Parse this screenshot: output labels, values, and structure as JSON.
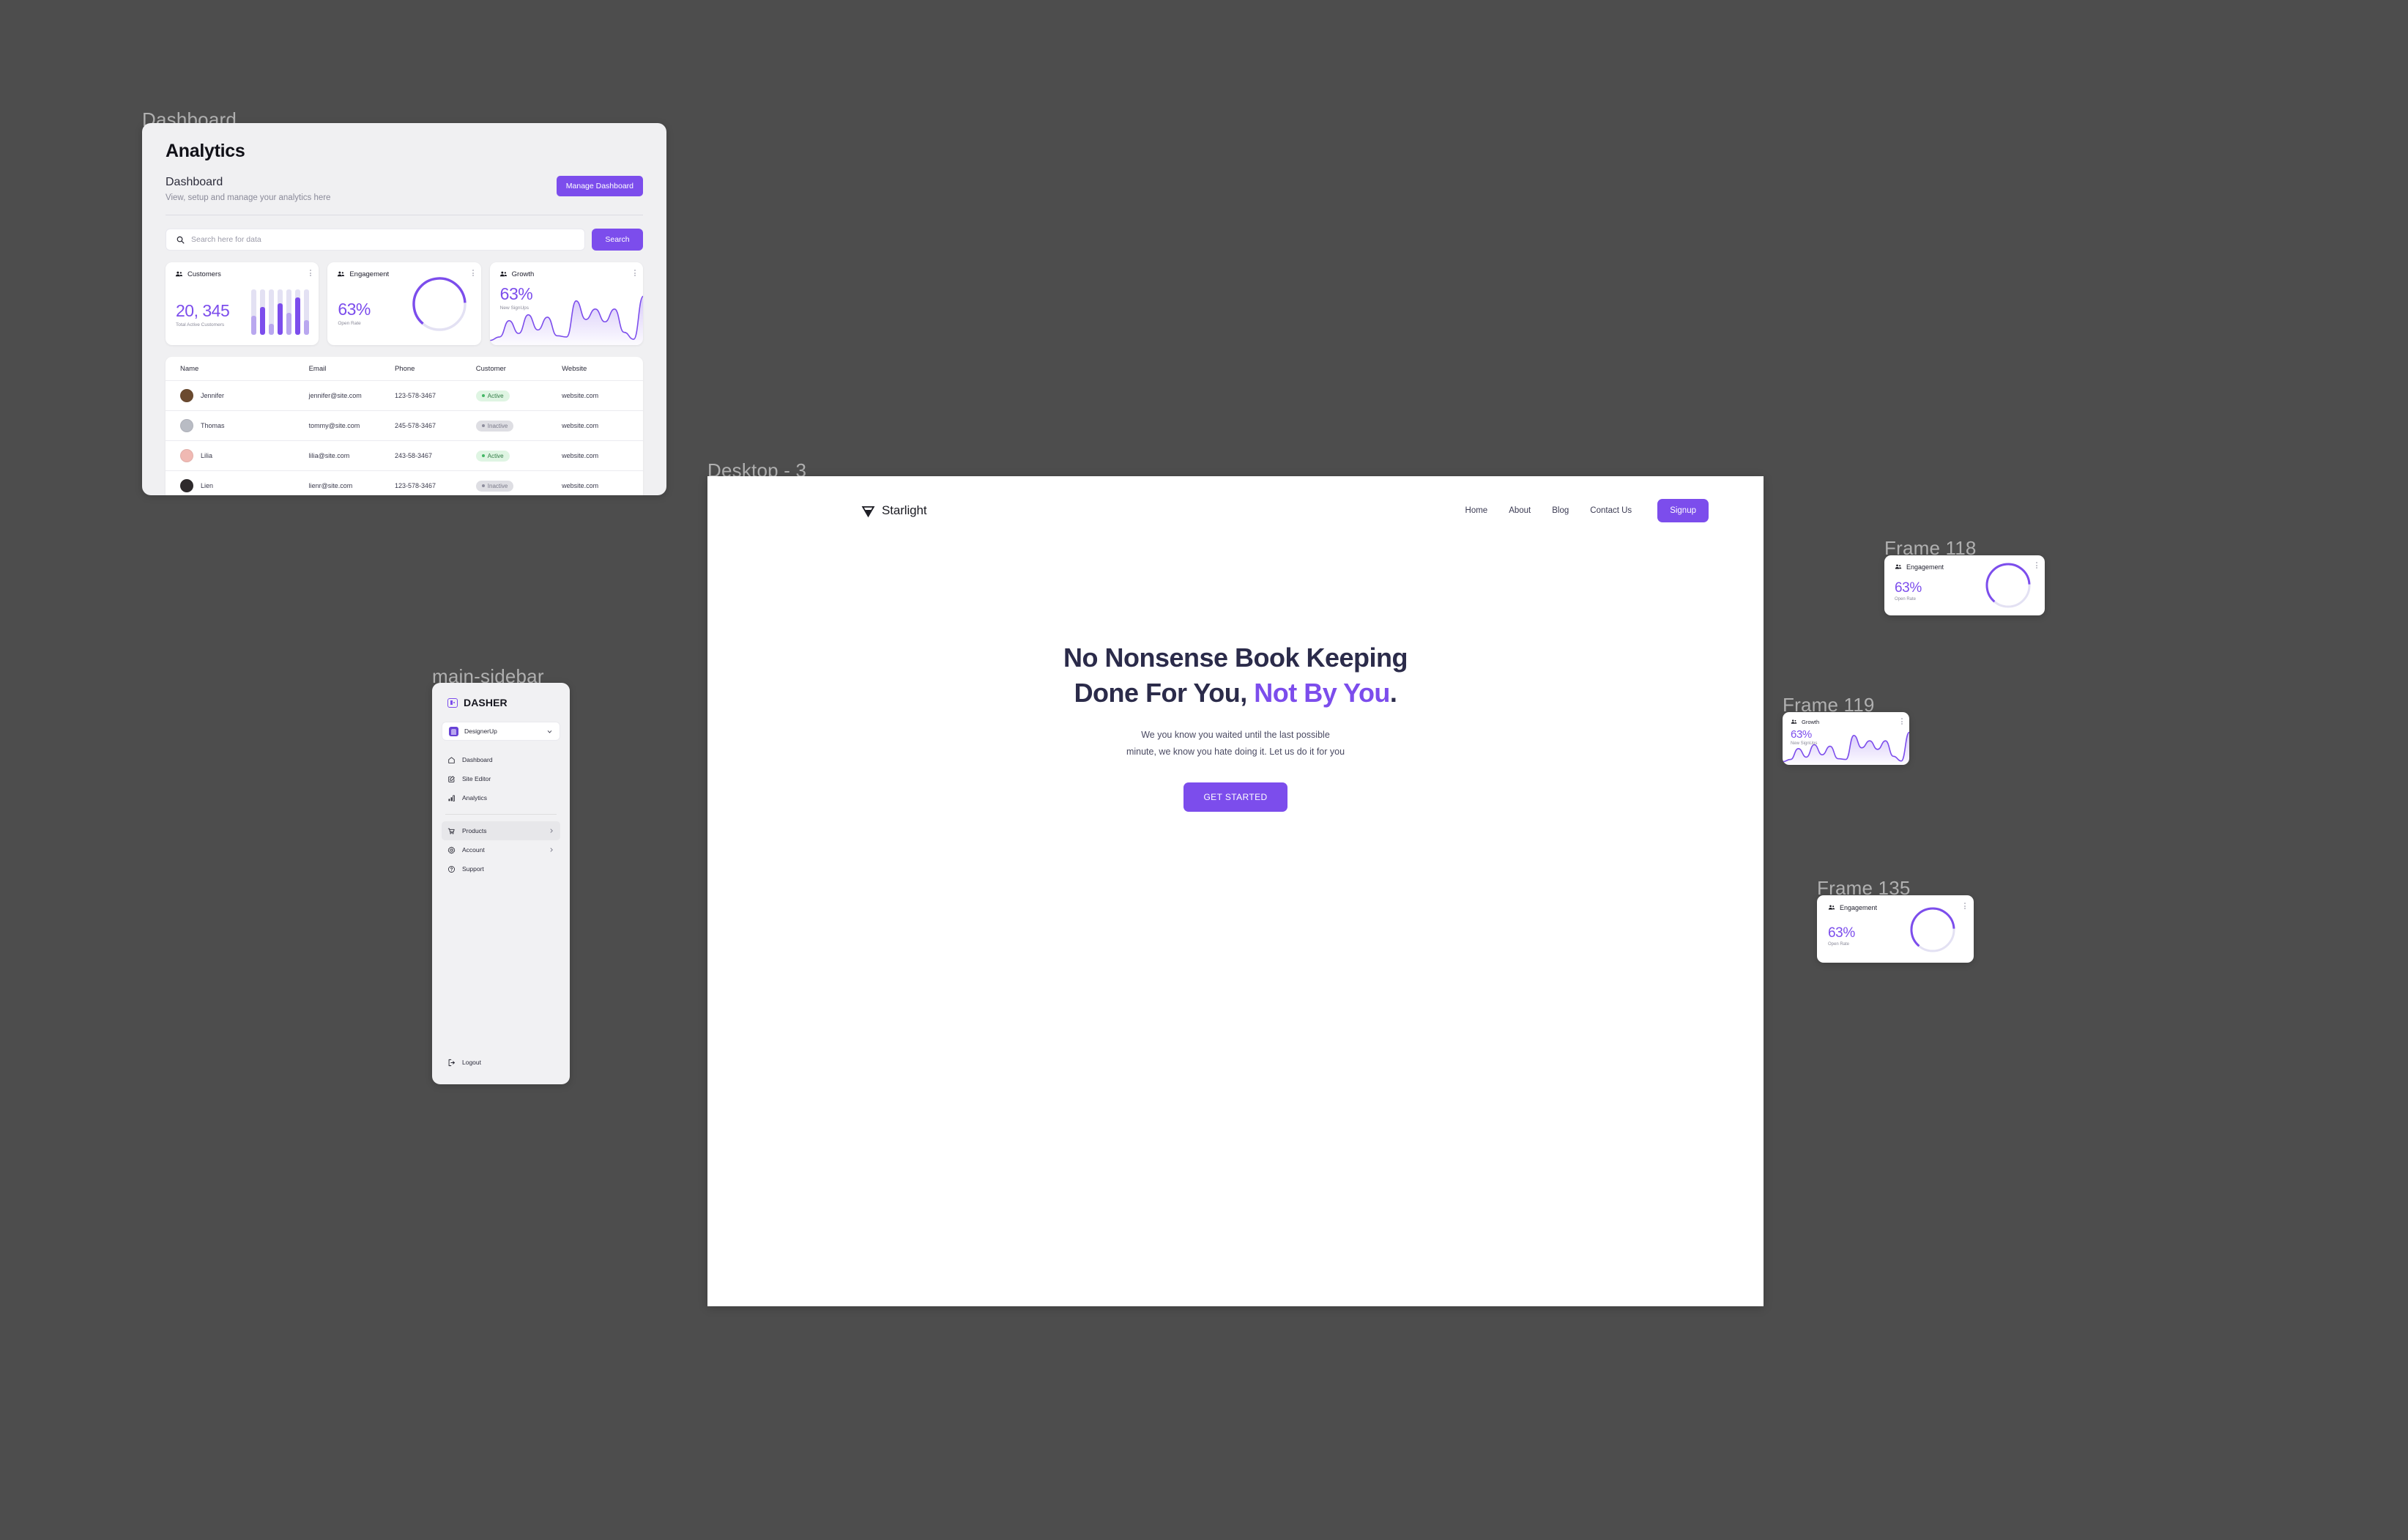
{
  "canvas": {
    "background": "#4d4d4d"
  },
  "accent": {
    "purple": "#7c4dec",
    "purple_light": "#b9a7ef",
    "track": "#e3e1f3",
    "green": "#45b866",
    "gray": "#8f8f9e"
  },
  "frames": {
    "dashboard_label": "Dashboard",
    "sidebar_label": "main-sidebar",
    "desktop_label": "Desktop - 3",
    "frame118_label": "Frame 118",
    "frame119_label": "Frame 119",
    "frame135_label": "Frame 135"
  },
  "dashboard": {
    "title": "Analytics",
    "subtitle": "Dashboard",
    "description": "View, setup and manage your analytics here",
    "manage_button": "Manage Dashboard",
    "search": {
      "placeholder": "Search here for data",
      "value": "",
      "button_label": "Search",
      "icon": "search-icon"
    },
    "cards": [
      {
        "id": "customers",
        "icon": "users-icon",
        "label": "Customers",
        "value": "20, 345",
        "sublabel": "Total Active Customers",
        "chart_type": "bar"
      },
      {
        "id": "engagement",
        "icon": "users-icon",
        "label": "Engagement",
        "value": "63%",
        "sublabel": "Open Rate",
        "chart_type": "donut"
      },
      {
        "id": "growth",
        "icon": "users-icon",
        "label": "Growth",
        "value": "63%",
        "sublabel": "New SignUps",
        "chart_type": "area"
      }
    ],
    "table": {
      "columns": [
        "Name",
        "Email",
        "Phone",
        "Customer",
        "Website"
      ],
      "rows": [
        {
          "name": "Jennifer",
          "email": "jennifer@site.com",
          "phone": "123-578-3467",
          "status": "Active",
          "website": "website.com",
          "avatar": "#6b4a2f"
        },
        {
          "name": "Thomas",
          "email": "tommy@site.com",
          "phone": "245-578-3467",
          "status": "Inactive",
          "website": "website.com",
          "avatar": "#b9bcc4"
        },
        {
          "name": "Lilia",
          "email": "lilia@site.com",
          "phone": "243-58-3467",
          "status": "Active",
          "website": "website.com",
          "avatar": "#f0b9b3"
        },
        {
          "name": "Lien",
          "email": "lienr@site.com",
          "phone": "123-578-3467",
          "status": "Inactive",
          "website": "website.com",
          "avatar": "#2e2a2c"
        }
      ]
    }
  },
  "sidebar": {
    "brand": "DASHER",
    "brand_icon": "dasher-logo-icon",
    "workspace": {
      "name": "DesignerUp",
      "chevron": "chevron-down-icon"
    },
    "items": [
      {
        "label": "Dashboard",
        "icon": "home-icon",
        "active": false,
        "expandable": false
      },
      {
        "label": "Site Editor",
        "icon": "edit-square-icon",
        "active": false,
        "expandable": false
      },
      {
        "label": "Analytics",
        "icon": "bar-chart-icon",
        "active": false,
        "expandable": false
      },
      {
        "label": "Products",
        "icon": "cart-icon",
        "active": true,
        "expandable": true
      },
      {
        "label": "Account",
        "icon": "gear-icon",
        "active": false,
        "expandable": true
      },
      {
        "label": "Support",
        "icon": "help-circle-icon",
        "active": false,
        "expandable": false
      }
    ],
    "logout": {
      "label": "Logout",
      "icon": "logout-icon"
    }
  },
  "desktop": {
    "logo": {
      "name": "Starlight",
      "icon": "starlight-triangle-icon"
    },
    "nav_links": [
      "Home",
      "About",
      "Blog",
      "Contact Us"
    ],
    "signup_label": "Signup",
    "hero": {
      "line1": "No Nonsense Book Keeping",
      "line2_plain": "Done For You,",
      "line2_accent": "Not By You",
      "line2_period": ".",
      "sub_line1": "We you know you waited until the last possible",
      "sub_line2": "minute, we know you hate doing it. Let us do it for you",
      "cta_label": "GET STARTED"
    }
  },
  "frame118": {
    "icon": "users-icon",
    "label": "Engagement",
    "value": "63%",
    "sublabel": "Open Rate"
  },
  "frame119": {
    "icon": "users-icon",
    "label": "Growth",
    "value": "63%",
    "sublabel": "New SignUps"
  },
  "frame135": {
    "icon": "users-icon",
    "label": "Engagement",
    "value": "63%",
    "sublabel": "Open Rate"
  },
  "chart_data": [
    {
      "id": "customers-bars",
      "type": "bar",
      "title": "Customers",
      "categories": [
        "1",
        "2",
        "3",
        "4",
        "5",
        "6",
        "7"
      ],
      "values": [
        42,
        62,
        25,
        70,
        48,
        82,
        33
      ],
      "track_max": 100,
      "colors": [
        "#b9a7ef",
        "#7c4dec",
        "#b9a7ef",
        "#7c4dec",
        "#b9a7ef",
        "#7c4dec",
        "#b9a7ef"
      ],
      "ylim": [
        0,
        100
      ],
      "grid": false,
      "legend": "none"
    },
    {
      "id": "engagement-donut",
      "type": "pie",
      "title": "Engagement",
      "categories": [
        "Open Rate",
        "Remaining"
      ],
      "values": [
        63,
        37
      ],
      "colors": [
        "#7c4dec",
        "#e3e1f3"
      ],
      "legend": "none"
    },
    {
      "id": "growth-area",
      "type": "area",
      "title": "Growth",
      "x": [
        0,
        1,
        2,
        3,
        4,
        5,
        6,
        7,
        8,
        9,
        10,
        11,
        12,
        13,
        14,
        15,
        16
      ],
      "values": [
        8,
        14,
        42,
        20,
        52,
        26,
        48,
        16,
        14,
        76,
        44,
        62,
        40,
        62,
        22,
        10,
        84
      ],
      "ylabel": "New SignUps",
      "colors": [
        "#7c4dec"
      ],
      "grid": false,
      "legend": "none"
    },
    {
      "id": "frame119-growth-area",
      "type": "area",
      "title": "Growth",
      "x": [
        0,
        1,
        2,
        3,
        4,
        5,
        6,
        7,
        8,
        9,
        10,
        11,
        12,
        13,
        14,
        15,
        16
      ],
      "values": [
        8,
        14,
        42,
        20,
        52,
        26,
        48,
        16,
        14,
        76,
        44,
        62,
        40,
        62,
        22,
        10,
        84
      ],
      "ylabel": "New SignUps",
      "colors": [
        "#7c4dec"
      ],
      "grid": false,
      "legend": "none"
    },
    {
      "id": "frame135-donut",
      "type": "pie",
      "title": "Engagement",
      "categories": [
        "Open Rate",
        "Remaining"
      ],
      "values": [
        63,
        37
      ],
      "colors": [
        "#7c4dec",
        "#e3e1f3"
      ],
      "legend": "none"
    }
  ]
}
